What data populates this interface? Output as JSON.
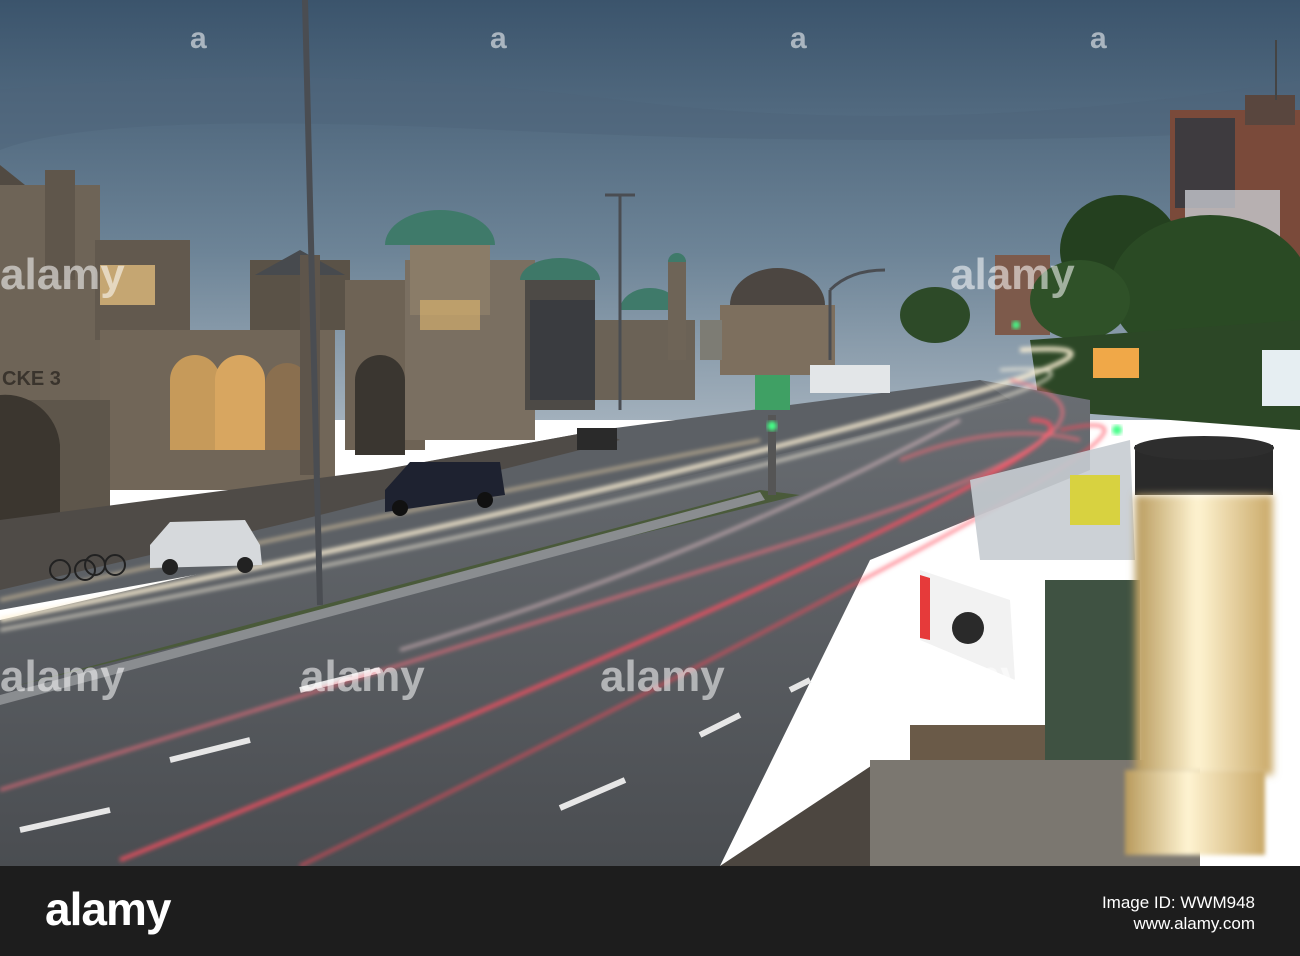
{
  "photo": {
    "subject": "Hamburg St. Pauli Landungsbrücken street at dusk with light trails",
    "colors": {
      "sky_top": "#3f5870",
      "sky_horizon": "#9aa9b6",
      "road": "#5d6064",
      "building": "#6b6156",
      "dome": "#3f7a6a",
      "trail_red": "#ff5060",
      "trail_white": "#fff2d6"
    },
    "building_sign": "CKE 3",
    "billboard_text": "",
    "watermarks": [
      "a",
      "a",
      "a",
      "a",
      "alamy",
      "alamy",
      "alamy",
      "alamy",
      "alamy",
      "alamy"
    ]
  },
  "footer": {
    "logo": "alamy",
    "image_id_label": "Image ID: WWM948",
    "site": "www.alamy.com"
  }
}
